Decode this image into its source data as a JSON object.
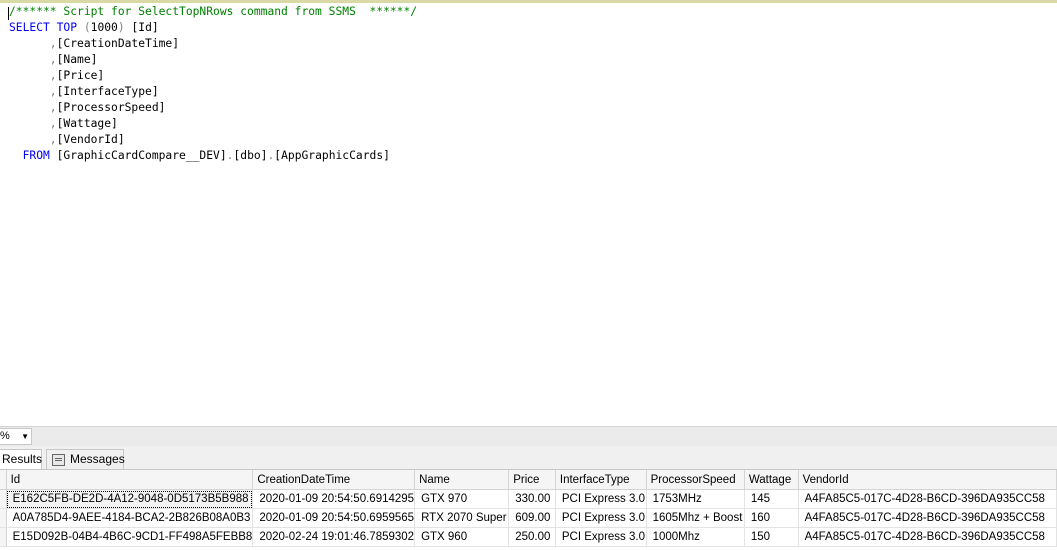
{
  "editor": {
    "lines": [
      {
        "parts": [
          {
            "t": "/****** Script for SelectTopNRows command from SSMS  ******/",
            "c": "cm"
          }
        ]
      },
      {
        "parts": [
          {
            "t": "SELECT TOP ",
            "c": "kw"
          },
          {
            "t": "(",
            "c": "gy"
          },
          {
            "t": "1000",
            "c": ""
          },
          {
            "t": ")",
            "c": "gy"
          },
          {
            "t": " [Id]",
            "c": ""
          }
        ]
      },
      {
        "parts": [
          {
            "t": "      ,",
            "c": "gy"
          },
          {
            "t": "[CreationDateTime]",
            "c": ""
          }
        ]
      },
      {
        "parts": [
          {
            "t": "      ,",
            "c": "gy"
          },
          {
            "t": "[Name]",
            "c": ""
          }
        ]
      },
      {
        "parts": [
          {
            "t": "      ,",
            "c": "gy"
          },
          {
            "t": "[Price]",
            "c": ""
          }
        ]
      },
      {
        "parts": [
          {
            "t": "      ,",
            "c": "gy"
          },
          {
            "t": "[InterfaceType]",
            "c": ""
          }
        ]
      },
      {
        "parts": [
          {
            "t": "      ,",
            "c": "gy"
          },
          {
            "t": "[ProcessorSpeed]",
            "c": ""
          }
        ]
      },
      {
        "parts": [
          {
            "t": "      ,",
            "c": "gy"
          },
          {
            "t": "[Wattage]",
            "c": ""
          }
        ]
      },
      {
        "parts": [
          {
            "t": "      ,",
            "c": "gy"
          },
          {
            "t": "[VendorId]",
            "c": ""
          }
        ]
      },
      {
        "parts": [
          {
            "t": "  FROM ",
            "c": "kw"
          },
          {
            "t": "[GraphicCardCompare__DEV]",
            "c": ""
          },
          {
            "t": ".",
            "c": "gy"
          },
          {
            "t": "[dbo]",
            "c": ""
          },
          {
            "t": ".",
            "c": "gy"
          },
          {
            "t": "[AppGraphicCards]",
            "c": ""
          }
        ]
      }
    ]
  },
  "zoom": {
    "value": "%"
  },
  "tabs": {
    "results": "Results",
    "messages": "Messages"
  },
  "grid": {
    "columns": [
      "Id",
      "CreationDateTime",
      "Name",
      "Price",
      "InterfaceType",
      "ProcessorSpeed",
      "Wattage",
      "VendorId"
    ],
    "rows": [
      [
        "E162C5FB-DE2D-4A12-9048-0D5173B5B988",
        "2020-01-09 20:54:50.6914295",
        "GTX 970",
        "330.00",
        "PCI Express 3.0",
        "1753MHz",
        "145",
        "A4FA85C5-017C-4D28-B6CD-396DA935CC58"
      ],
      [
        "A0A785D4-9AEE-4184-BCA2-2B826B08A0B3",
        "2020-01-09 20:54:50.6959565",
        "RTX 2070 Super",
        "609.00",
        "PCI Express 3.0",
        "1605Mhz + Boost",
        "160",
        "A4FA85C5-017C-4D28-B6CD-396DA935CC58"
      ],
      [
        "E15D092B-04B4-4B6C-9CD1-FF498A5FEBB8",
        "2020-02-24 19:01:46.7859302",
        "GTX 960",
        "250.00",
        "PCI Express 3.0",
        "1000Mhz",
        "150",
        "A4FA85C5-017C-4D28-B6CD-396DA935CC58"
      ]
    ]
  }
}
